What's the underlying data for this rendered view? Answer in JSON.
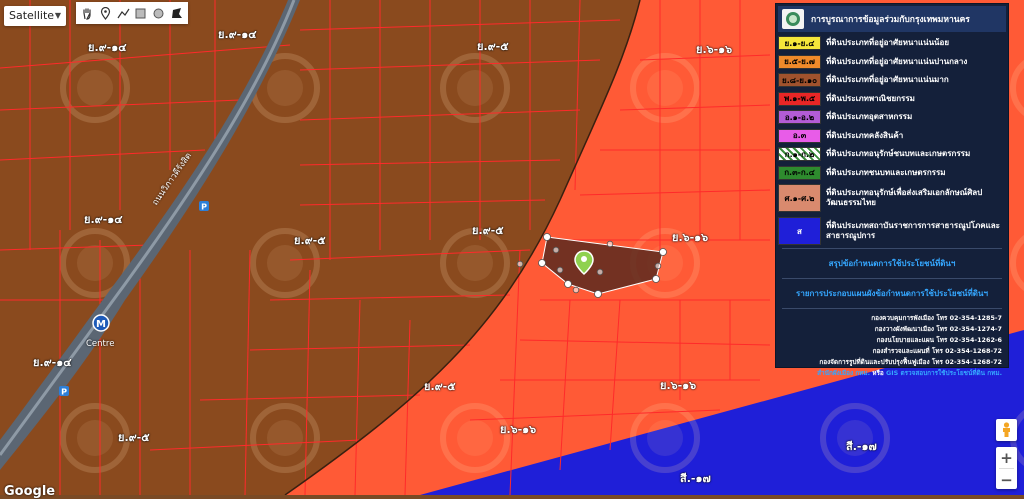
{
  "map": {
    "type_selector": {
      "value": "Satellite"
    },
    "drawing_tools": [
      "hand-icon",
      "pin-icon",
      "polyline-icon",
      "rectangle-icon",
      "circle-icon",
      "polygon-icon"
    ],
    "colors": {
      "residential_high": "#8a4a1e",
      "commercial_red": "#ff5a36",
      "government_blue": "#1f1fd8",
      "parcel_line": "#ff2a2a",
      "selected_parcel": "#5a2a1e"
    },
    "zone_labels": [
      "ย.๙-๑๔",
      "ย.๙-๑๔",
      "ย.๙-๕",
      "ย.๖-๑๖",
      "ย.๙-๑๔",
      "ย.๙-๕",
      "ย.๙-๕",
      "ย.๖-๑๖",
      "ย.๙-๑๔",
      "ย.๙-๕",
      "ย.๖-๑๖",
      "ย.๙-๕",
      "ย.๖-๑๖",
      "สี.-๑๗",
      "สี.-๑๗"
    ],
    "place_labels": [
      "ถนนวิภาวดีรังสิต",
      "Centre"
    ]
  },
  "legend": {
    "title": "การบูรณาการข้อมูลร่วมกับกรุงเทพมหานคร",
    "rows": [
      {
        "code": "ย.๑-ย.๔",
        "label": "ที่ดินประเภทที่อยู่อาศัยหนาแน่นน้อย",
        "color": "#f5e63a"
      },
      {
        "code": "ย.๕-ย.๗",
        "label": "ที่ดินประเภทที่อยู่อาศัยหนาแน่นปานกลาง",
        "color": "#f08a2a"
      },
      {
        "code": "ย.๘-ย.๑๐",
        "label": "ที่ดินประเภทที่อยู่อาศัยหนาแน่นมาก",
        "color": "#a0522d"
      },
      {
        "code": "พ.๑-พ.๕",
        "label": "ที่ดินประเภทพาณิชยกรรม",
        "color": "#e82626"
      },
      {
        "code": "อ.๑-อ.๒",
        "label": "ที่ดินประเภทอุตสาหกรรม",
        "color": "#b35cd6"
      },
      {
        "code": "อ.๓",
        "label": "ที่ดินประเภทคลังสินค้า",
        "color": "#e85ce8"
      },
      {
        "code": "ก.๑-ก.๒",
        "label": "ที่ดินประเภทอนุรักษ์ชนบทและเกษตรกรรม",
        "color": "#dff0dc"
      },
      {
        "code": "ก.๓-ก.๔",
        "label": "ที่ดินประเภทชนบทและเกษตรกรรม",
        "color": "#2e8b2e"
      },
      {
        "code": "ศ.๑-ศ.๒",
        "label": "ที่ดินประเภทอนุรักษ์เพื่อส่งเสริมเอกลักษณ์ศิลปวัฒนธรรมไทย",
        "color": "#d98a6e"
      },
      {
        "code": "ส",
        "label": "ที่ดินประเภทสถาบันราชการการสาธารณูปโภคและสาธารณูปการ",
        "color": "#1f1fd8"
      }
    ],
    "link_summary": "สรุปข้อกำหนดการใช้ประโยชน์ที่ดินฯ",
    "link_details": "รายการประกอบแผนผังข้อกำหนดการใช้ประโยชน์ที่ดินฯ",
    "contacts": [
      "กองควบคุมการพังเมือง โทร 02-354-1285-7",
      "กองวางผังพัฒนาเมือง โทร 02-354-1274-7",
      "กองนโยบายและแผน โทร 02-354-1262-6",
      "กองสำรวจและแผนที่ โทร 02-354-1268-72",
      "กองจัดการรูปที่ดินและปรับปรุงฟื้นฟูเมือง โทร 02-354-1268-72"
    ],
    "footer_link_a": "สำนักผังเมือง กทม.",
    "footer_or": "หรือ",
    "footer_link_b": "GIS ตรวจสอบการใช้ประโยชน์ที่ดิน กทม."
  },
  "controls": {
    "zoom_in": "+",
    "zoom_out": "−",
    "google": "Google"
  }
}
